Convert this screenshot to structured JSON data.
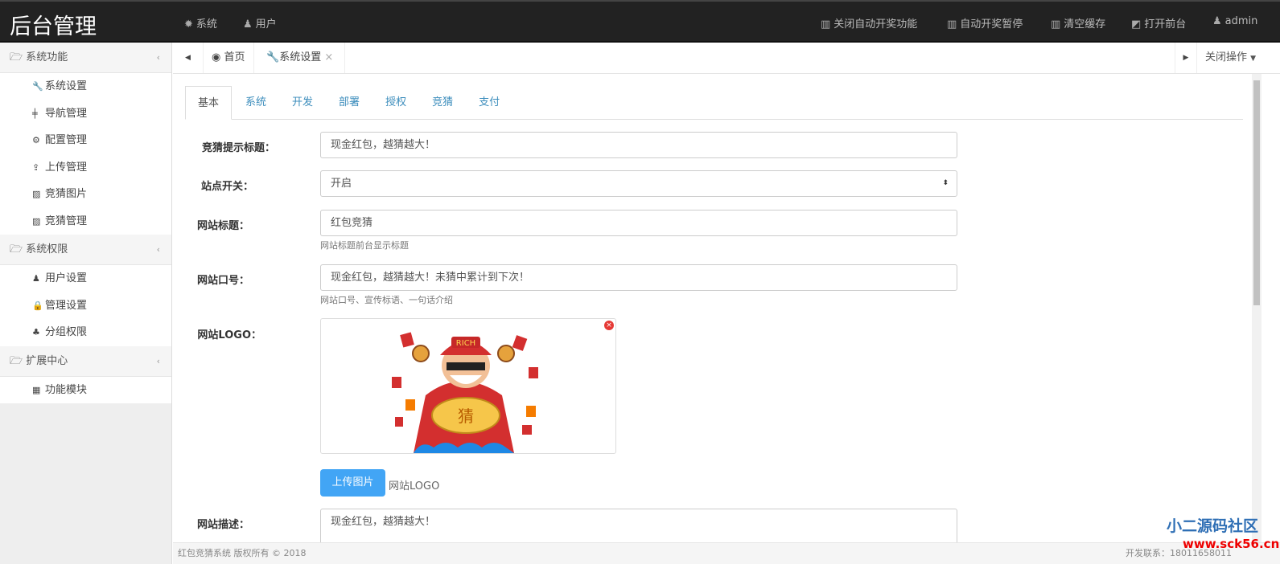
{
  "header": {
    "title": "后台管理",
    "nav": [
      {
        "icon": "gear-icon",
        "label": "系统"
      },
      {
        "icon": "user-icon",
        "label": "用户"
      }
    ],
    "actions": [
      {
        "icon": "trash-icon",
        "label": "关闭自动开奖功能"
      },
      {
        "icon": "trash-icon",
        "label": "自动开奖暂停"
      },
      {
        "icon": "trash-icon",
        "label": "清空缓存"
      },
      {
        "icon": "external-link-icon",
        "label": "打开前台"
      },
      {
        "icon": "user-icon",
        "label": "admin"
      }
    ]
  },
  "sidebar": {
    "groups": [
      {
        "label": "系统功能",
        "items": [
          {
            "icon": "wrench-icon",
            "label": "系统设置"
          },
          {
            "icon": "nav-icon",
            "label": "导航管理"
          },
          {
            "icon": "cogs-icon",
            "label": "配置管理"
          },
          {
            "icon": "upload-icon",
            "label": "上传管理"
          },
          {
            "icon": "image-icon",
            "label": "竞猜图片"
          },
          {
            "icon": "image-icon",
            "label": "竞猜管理"
          }
        ]
      },
      {
        "label": "系统权限",
        "items": [
          {
            "icon": "user-icon",
            "label": "用户设置"
          },
          {
            "icon": "lock-icon",
            "label": "管理设置"
          },
          {
            "icon": "sitemap-icon",
            "label": "分组权限"
          }
        ]
      },
      {
        "label": "扩展中心",
        "items": [
          {
            "icon": "grid-icon",
            "label": "功能模块"
          }
        ]
      }
    ]
  },
  "tabbar": {
    "home": "首页",
    "current": "系统设置",
    "close_ops": "关闭操作"
  },
  "tabs": [
    "基本",
    "系统",
    "开发",
    "部署",
    "授权",
    "竞猜",
    "支付"
  ],
  "form": {
    "guess_title": {
      "label": "竞猜提示标题：",
      "value": "现金红包，越猜越大！"
    },
    "site_switch": {
      "label": "站点开关：",
      "value": "开启"
    },
    "site_title": {
      "label": "网站标题：",
      "value": "红包竞猜",
      "help": "网站标题前台显示标题"
    },
    "slogan": {
      "label": "网站口号：",
      "value": "现金红包，越猜越大！未猜中累计到下次！",
      "help": "网站口号、宣传标语、一句话介绍"
    },
    "logo": {
      "label": "网站LOGO：",
      "upload": "上传图片",
      "hint": "网站LOGO",
      "badge_text": "RICH",
      "gold_text": "猜"
    },
    "description": {
      "label": "网站描述：",
      "value": "现金红包，越猜越大！"
    }
  },
  "footer": {
    "left": "红包竞猜系统 版权所有 © 2018",
    "right": "开发联系：18011658011"
  },
  "watermark": {
    "name": "小二源码社区",
    "url": "www.sck56.cn"
  }
}
